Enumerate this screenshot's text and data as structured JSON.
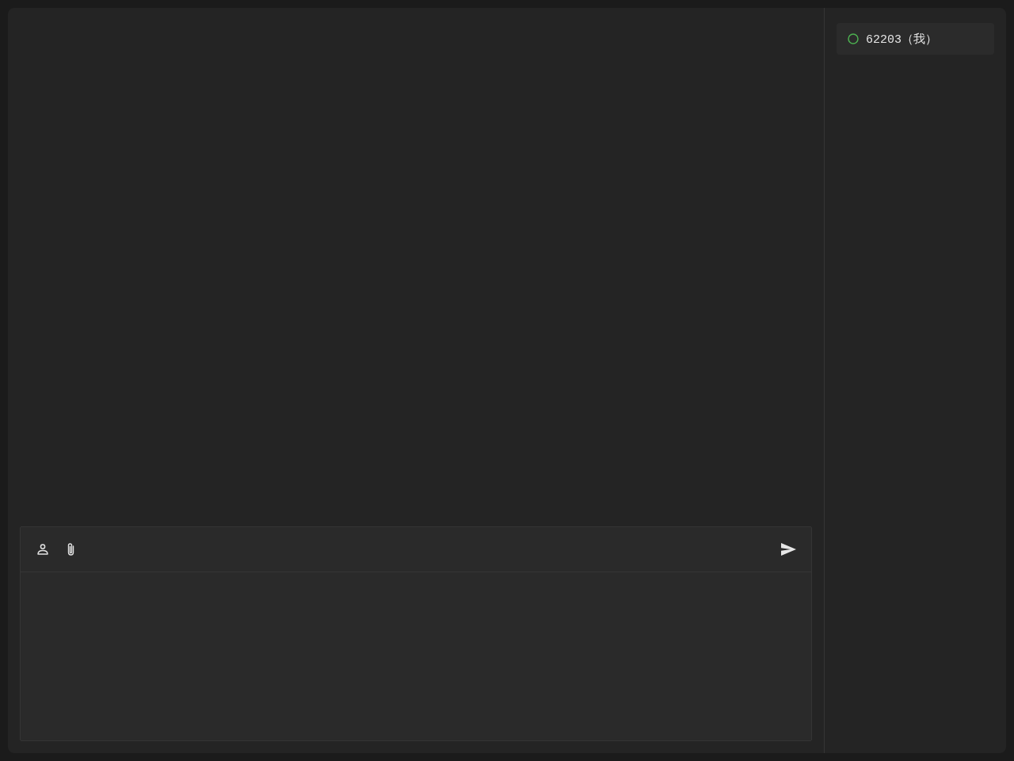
{
  "users": [
    {
      "name": "62203（我）",
      "online": true
    }
  ]
}
